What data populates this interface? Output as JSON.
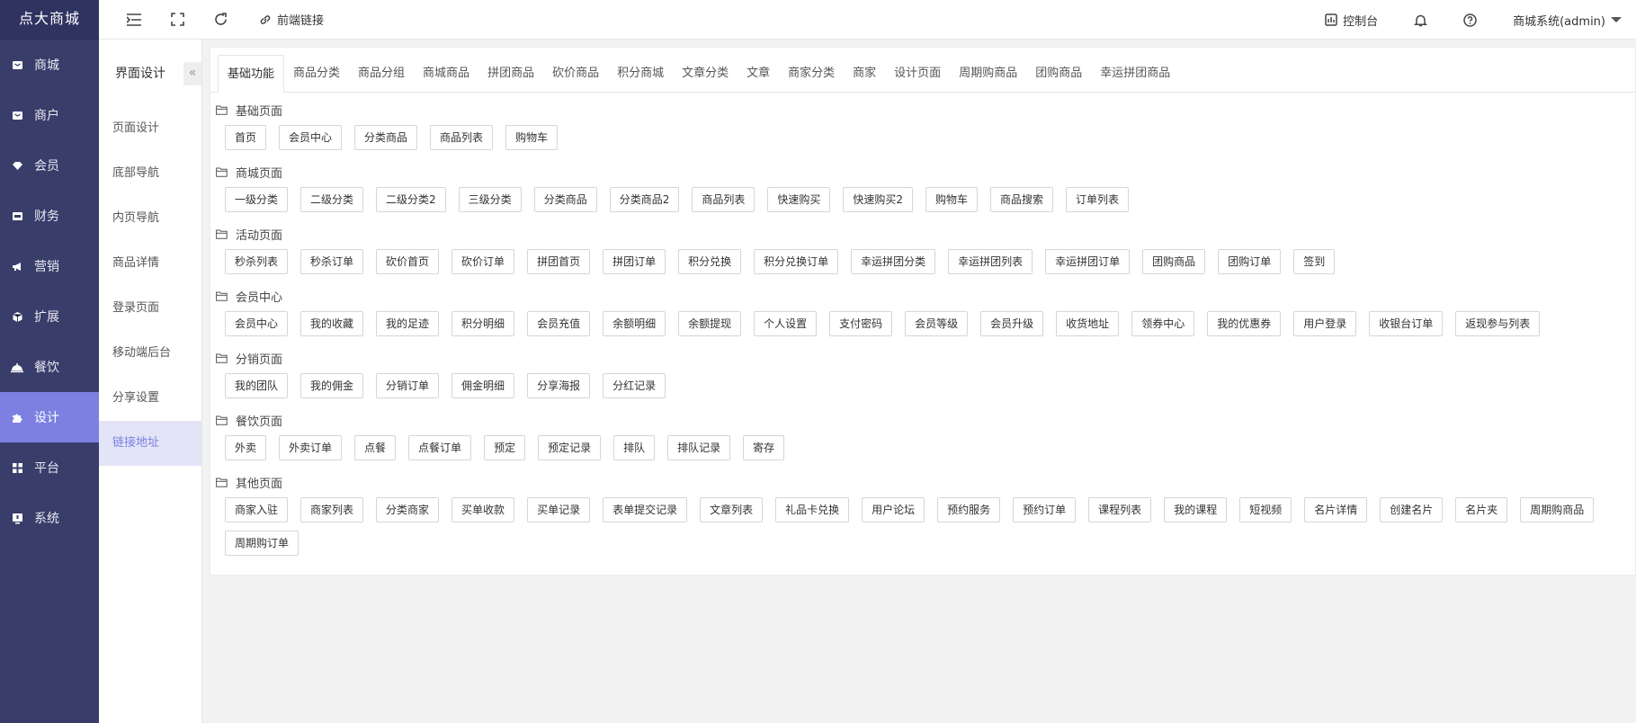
{
  "app": {
    "logo": "点大商城"
  },
  "sidebar": {
    "items": [
      {
        "label": "商城",
        "icon": "store-icon",
        "active": false
      },
      {
        "label": "商户",
        "icon": "shop-icon",
        "active": false
      },
      {
        "label": "会员",
        "icon": "diamond-icon",
        "active": false
      },
      {
        "label": "财务",
        "icon": "wallet-icon",
        "active": false
      },
      {
        "label": "营销",
        "icon": "megaphone-icon",
        "active": false
      },
      {
        "label": "扩展",
        "icon": "cube-icon",
        "active": false
      },
      {
        "label": "餐饮",
        "icon": "dining-icon",
        "active": false
      },
      {
        "label": "设计",
        "icon": "puzzle-icon",
        "active": true
      },
      {
        "label": "平台",
        "icon": "grid-icon",
        "active": false
      },
      {
        "label": "系统",
        "icon": "system-icon",
        "active": false
      }
    ]
  },
  "subnav": {
    "title": "界面设计",
    "collapse": "«",
    "items": [
      {
        "label": "页面设计",
        "active": false
      },
      {
        "label": "底部导航",
        "active": false
      },
      {
        "label": "内页导航",
        "active": false
      },
      {
        "label": "商品详情",
        "active": false
      },
      {
        "label": "登录页面",
        "active": false
      },
      {
        "label": "移动端后台",
        "active": false
      },
      {
        "label": "分享设置",
        "active": false
      },
      {
        "label": "链接地址",
        "active": true
      }
    ]
  },
  "header": {
    "frontend_link": "前端链接",
    "console": "控制台",
    "user": "商城系统(admin)"
  },
  "tabs": [
    {
      "label": "基础功能",
      "active": true
    },
    {
      "label": "商品分类"
    },
    {
      "label": "商品分组"
    },
    {
      "label": "商城商品"
    },
    {
      "label": "拼团商品"
    },
    {
      "label": "砍价商品"
    },
    {
      "label": "积分商城"
    },
    {
      "label": "文章分类"
    },
    {
      "label": "文章"
    },
    {
      "label": "商家分类"
    },
    {
      "label": "商家"
    },
    {
      "label": "设计页面"
    },
    {
      "label": "周期购商品"
    },
    {
      "label": "团购商品"
    },
    {
      "label": "幸运拼团商品"
    }
  ],
  "sections": [
    {
      "title": "基础页面",
      "links": [
        "首页",
        "会员中心",
        "分类商品",
        "商品列表",
        "购物车"
      ]
    },
    {
      "title": "商城页面",
      "links": [
        "一级分类",
        "二级分类",
        "二级分类2",
        "三级分类",
        "分类商品",
        "分类商品2",
        "商品列表",
        "快速购买",
        "快速购买2",
        "购物车",
        "商品搜索",
        "订单列表"
      ]
    },
    {
      "title": "活动页面",
      "links": [
        "秒杀列表",
        "秒杀订单",
        "砍价首页",
        "砍价订单",
        "拼团首页",
        "拼团订单",
        "积分兑换",
        "积分兑换订单",
        "幸运拼团分类",
        "幸运拼团列表",
        "幸运拼团订单",
        "团购商品",
        "团购订单",
        "签到"
      ]
    },
    {
      "title": "会员中心",
      "links": [
        "会员中心",
        "我的收藏",
        "我的足迹",
        "积分明细",
        "会员充值",
        "余额明细",
        "余额提现",
        "个人设置",
        "支付密码",
        "会员等级",
        "会员升级",
        "收货地址",
        "领券中心",
        "我的优惠券",
        "用户登录",
        "收银台订单",
        "返现参与列表"
      ]
    },
    {
      "title": "分销页面",
      "links": [
        "我的团队",
        "我的佣金",
        "分销订单",
        "佣金明细",
        "分享海报",
        "分红记录"
      ]
    },
    {
      "title": "餐饮页面",
      "links": [
        "外卖",
        "外卖订单",
        "点餐",
        "点餐订单",
        "预定",
        "预定记录",
        "排队",
        "排队记录",
        "寄存"
      ]
    },
    {
      "title": "其他页面",
      "links": [
        "商家入驻",
        "商家列表",
        "分类商家",
        "买单收款",
        "买单记录",
        "表单提交记录",
        "文章列表",
        "礼品卡兑换",
        "用户论坛",
        "预约服务",
        "预约订单",
        "课程列表",
        "我的课程",
        "短视频",
        "名片详情",
        "创建名片",
        "名片夹",
        "周期购商品",
        "周期购订单"
      ]
    }
  ]
}
